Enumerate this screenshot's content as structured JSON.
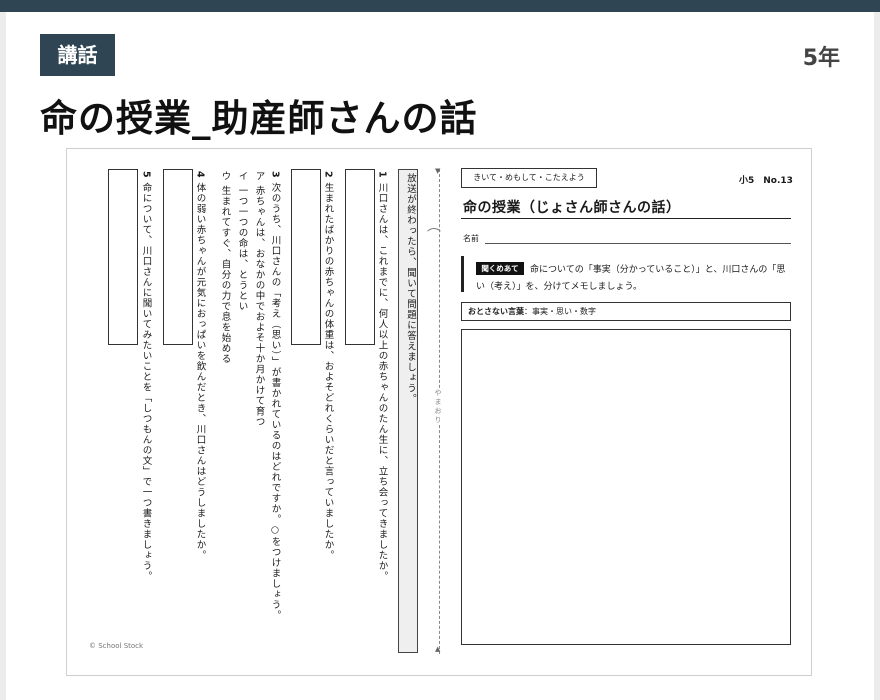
{
  "header": {
    "tag": "講話",
    "grade": "5年",
    "title": "命の授業_助産師さんの話"
  },
  "worksheet": {
    "instruction": "放送が終わったら、聞いて問題に答えましょう。",
    "questions": [
      {
        "num": "1",
        "text": "川口さんは、これまでに、何人以上の赤ちゃんのたん生に、立ち会ってきましたか。"
      },
      {
        "num": "2",
        "text": "生まれたばかりの赤ちゃんの体重は、およそどれくらいだと言っていましたか。"
      },
      {
        "num": "3",
        "text": "次のうち、川口さんの「考え（思い）」が書かれているのはどれですか。○をつけましょう。"
      },
      {
        "num": "4",
        "text": "体の弱い赤ちゃんが元気におっぱいを飲んだとき、川口さんはどうしましたか。"
      },
      {
        "num": "5",
        "text": "命について、川口さんに聞いてみたいことを「しつもんの文」で一つ書きましょう。"
      }
    ],
    "options": [
      {
        "label": "ア",
        "text": "赤ちゃんは、おなかの中でおよそ十か月かけて育つ"
      },
      {
        "label": "イ",
        "text": "一つ一つの命は、とうとい"
      },
      {
        "label": "ウ",
        "text": "生まれてすぐ、自分の力で息を始める"
      }
    ],
    "copyright": "© School Stock",
    "fold_label": "やまおり",
    "right": {
      "kikite": "きいて・めもして・こたえよう",
      "number": "小5　No.13",
      "title": "命の授業（じょさん師さんの話）",
      "name_label": "名前",
      "listen_badge": "聞くめあて",
      "listen_text_1": "命についての「事実（分かっていること）」と、川口さんの「思",
      "listen_text_2": "い（考え）」を、分けてメモしましょう。",
      "words_label": "おとさない言葉",
      "words_text": "：事実・思い・数字"
    }
  }
}
